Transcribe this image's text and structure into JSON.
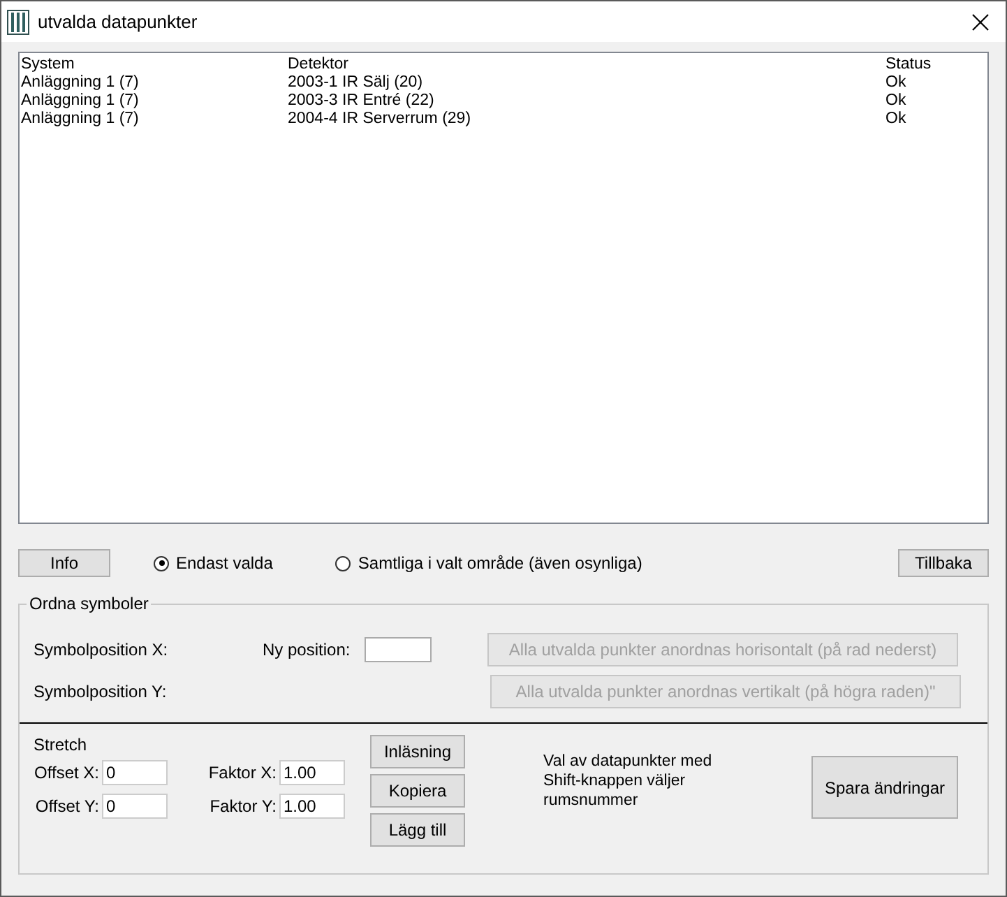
{
  "window": {
    "title": "utvalda datapunkter"
  },
  "list": {
    "columns": [
      "System",
      "Detektor",
      "Status"
    ],
    "rows": [
      [
        "Anläggning 1 (7)",
        "2003-1 IR Sälj (20)",
        "Ok"
      ],
      [
        "Anläggning 1 (7)",
        "2003-3 IR Entré (22)",
        "Ok"
      ],
      [
        "Anläggning 1 (7)",
        "2004-4 IR Serverrum (29)",
        "Ok"
      ]
    ]
  },
  "info_button": "Info",
  "scope_options": [
    {
      "label": "Endast valda",
      "selected": true
    },
    {
      "label": "Samtliga i valt område (även osynliga)",
      "selected": false
    }
  ],
  "back_button": "Tillbaka",
  "arrange": {
    "title": "Ordna symboler",
    "position_x_label": "Symbolposition X:",
    "position_y_label": "Symbolposition Y:",
    "new_position_label": "Ny position:",
    "horizontal_button": {
      "label": "Alla utvalda punkter anordnas horisontalt (på rad nederst)",
      "disabled": true
    },
    "vertical_button": {
      "label": "Alla utvalda punkter anordnas vertikalt (på högra raden)\"",
      "disabled": true
    }
  },
  "stretch": {
    "title": "Stretch",
    "fields": [
      {
        "label": "Offset X:",
        "value": "0"
      },
      {
        "label": "Faktor X:",
        "value": "1.00"
      },
      {
        "label": "Offset Y:",
        "value": "0"
      },
      {
        "label": "Faktor Y:",
        "value": "1.00"
      }
    ],
    "buttons": [
      "Inläsning",
      "Kopiera",
      "Lägg till"
    ],
    "note": "Val av datapunkter med Shift-knappen väljer rumsnummer",
    "save_button": "Spara ändringar"
  }
}
